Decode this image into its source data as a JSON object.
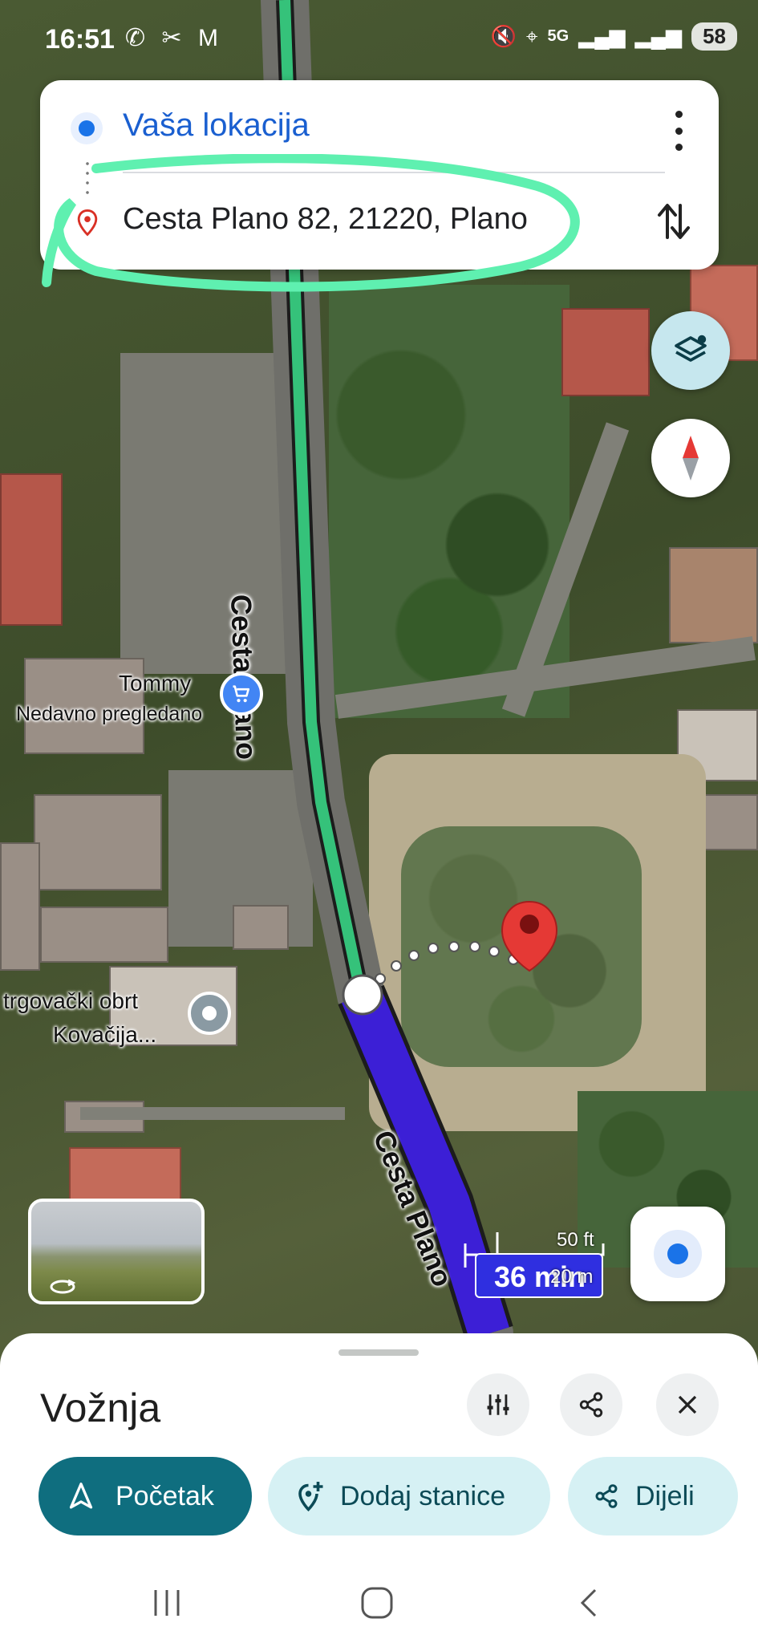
{
  "status_bar": {
    "time": "16:51",
    "left_icons": "✆ ✂ M",
    "network": "5G",
    "battery": "58"
  },
  "directions": {
    "origin": "Vaša lokacija",
    "destination": "Cesta Plano 82, 21220, Plano"
  },
  "map": {
    "street_label_1": "Cesta Plano",
    "street_label_2": "Cesta Plano",
    "poi_1_name": "Tommy",
    "poi_1_sub": "Nedavno pregledano",
    "poi_2_line1": "trgovački obrt",
    "poi_2_line2": "Kovačija...",
    "route_time": "36 min",
    "scale_ft": "50 ft",
    "scale_m": "20 m"
  },
  "sheet": {
    "title": "Vožnja",
    "start_label": "Početak",
    "add_stops_label": "Dodaj stanice",
    "share_label": "Dijeli"
  },
  "colors": {
    "accent_blue": "#1a73e8",
    "route_active": "#3c1fd6",
    "route_upcoming": "#35c27a",
    "highlight": "#5ff0b0",
    "start_chip": "#0f6e7f",
    "secondary_chip": "#d6f1f4",
    "destination_pin": "#e53935"
  },
  "icons": [
    "origin-dot-icon",
    "destination-pin-icon",
    "more-vert-icon",
    "swap-icon",
    "layers-icon",
    "compass-icon",
    "my-location-icon",
    "street-view-icon",
    "tune-icon",
    "share-icon",
    "close-icon",
    "navigation-arrow-icon",
    "add-stop-icon",
    "recents-icon",
    "home-icon",
    "back-icon",
    "shopping-cart-icon"
  ]
}
